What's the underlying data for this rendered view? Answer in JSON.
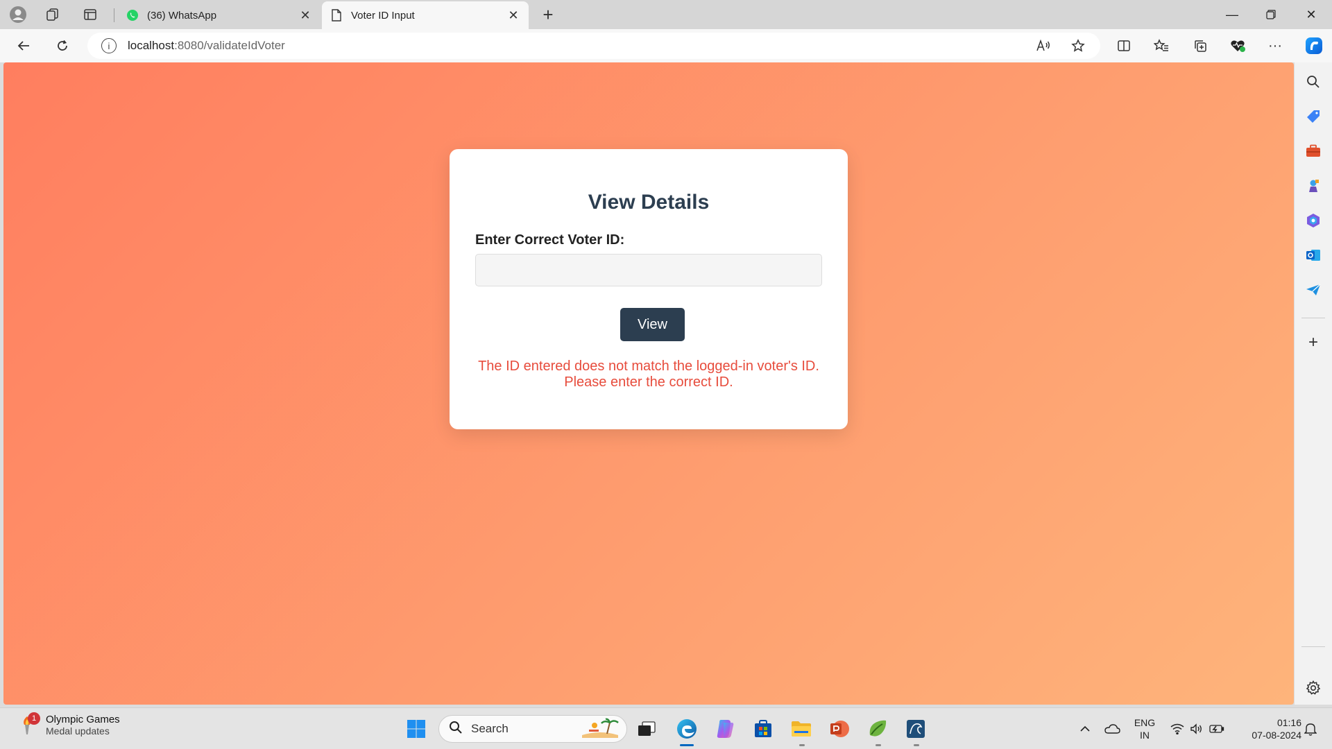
{
  "browser": {
    "tabs": [
      {
        "title": "(36) WhatsApp",
        "icon": "whatsapp-icon",
        "active": false
      },
      {
        "title": "Voter ID Input",
        "icon": "page-icon",
        "active": true
      }
    ],
    "address": {
      "host": "localhost",
      "path": ":8080/validateIdVoter"
    }
  },
  "page": {
    "heading": "View Details",
    "field_label": "Enter Correct Voter ID:",
    "voter_id_value": "",
    "view_button": "View",
    "error_line1": "The ID entered does not match the logged-in voter's ID.",
    "error_line2": "Please enter the correct ID.",
    "colors": {
      "gradient_start": "#ff7e5f",
      "gradient_end": "#feb47b",
      "heading": "#2c3e50",
      "button": "#2c3e50",
      "error": "#e74c3c"
    }
  },
  "taskbar": {
    "news_badge": "1",
    "news_title": "Olympic Games",
    "news_subtitle": "Medal updates",
    "search_placeholder": "Search",
    "lang_line1": "ENG",
    "lang_line2": "IN",
    "time": "01:16",
    "date": "07-08-2024"
  }
}
